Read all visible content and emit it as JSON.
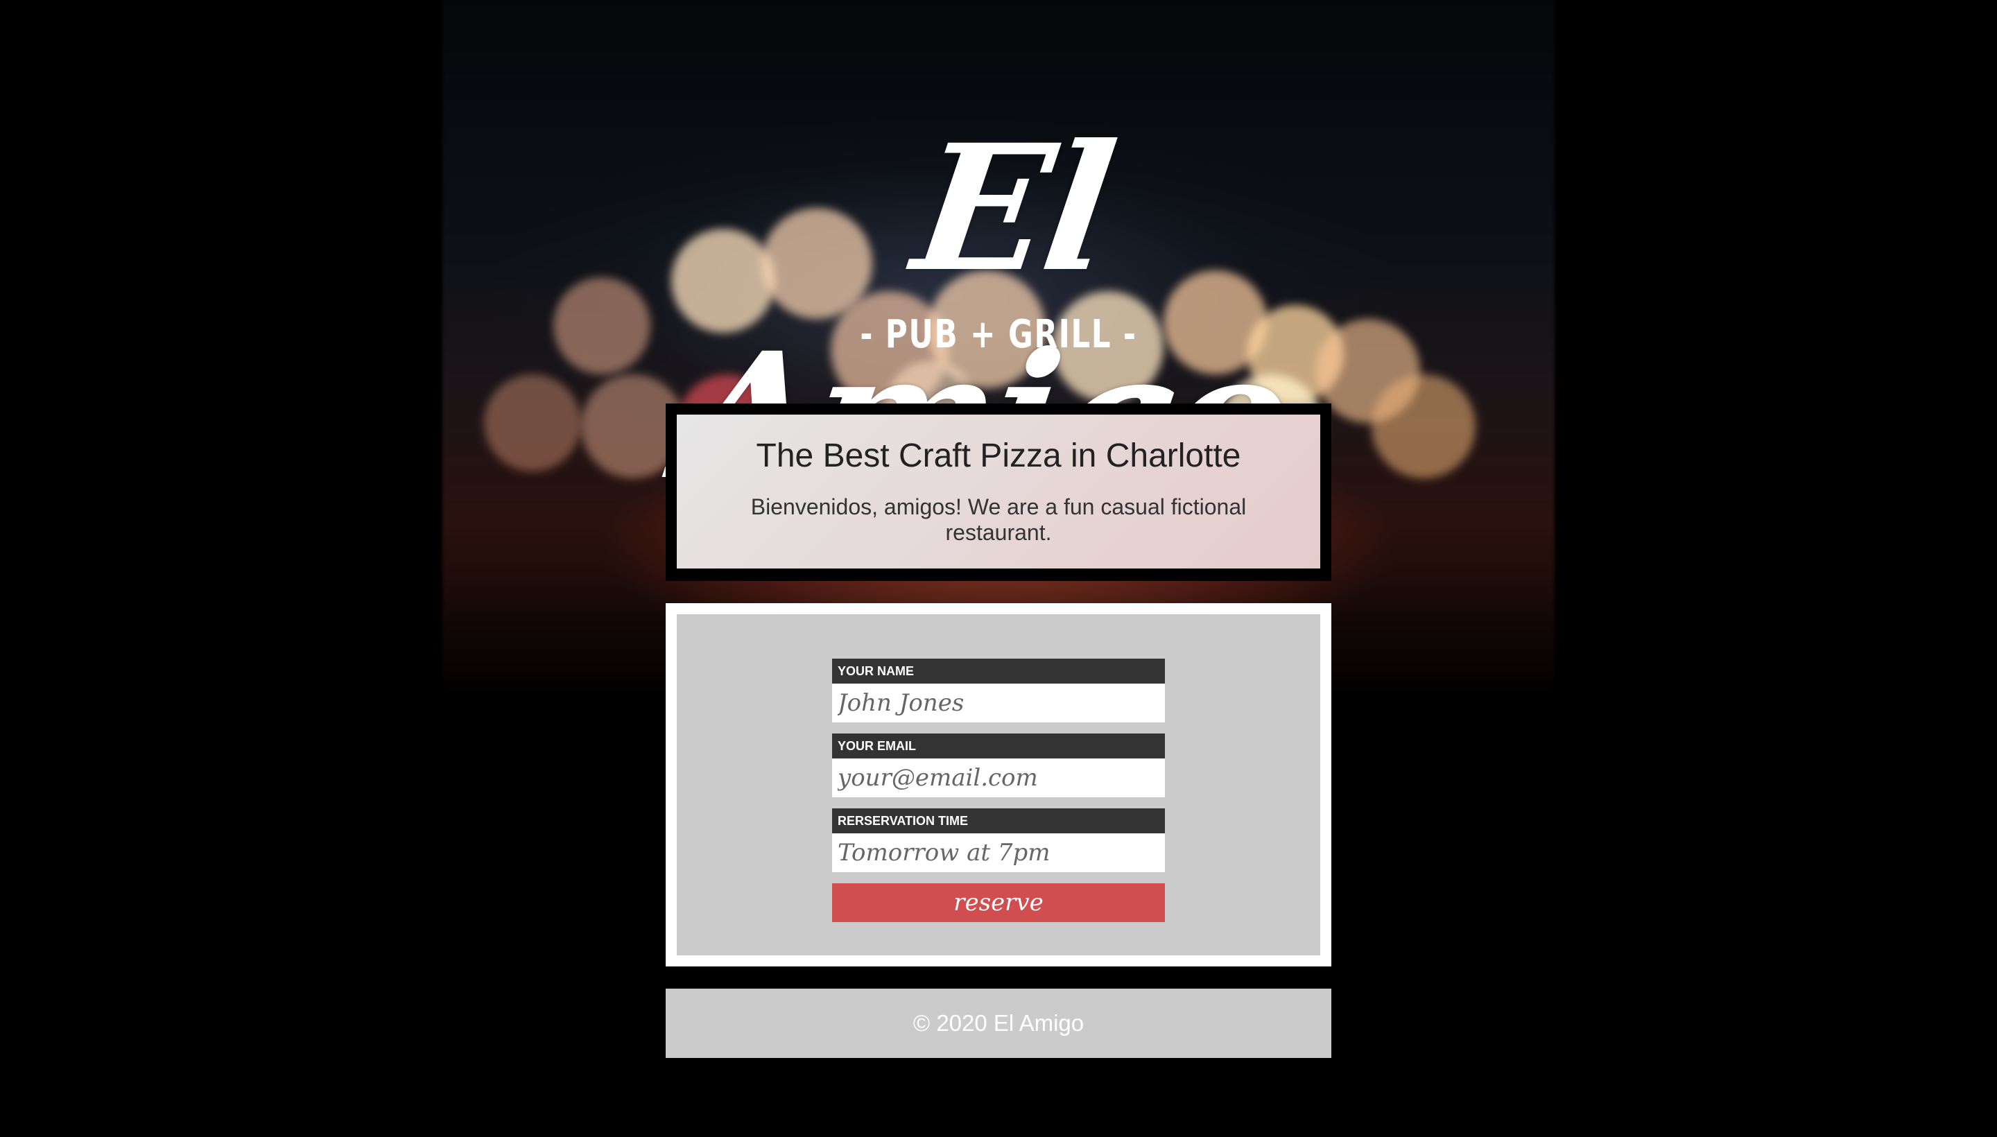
{
  "brand": {
    "logo_script": "El Amigo",
    "logo_sub": "- PUB + GRILL -"
  },
  "intro": {
    "title": "The Best Craft Pizza in Charlotte",
    "text": "Bienvenidos, amigos! We are a fun casual fictional restaurant."
  },
  "form": {
    "name_label": "YOUR NAME",
    "name_placeholder": "John Jones",
    "email_label": "YOUR EMAIL",
    "email_placeholder": "your@email.com",
    "time_label": "RERSERVATION TIME",
    "time_placeholder": "Tomorrow at 7pm",
    "submit_label": "reserve"
  },
  "footer": {
    "copyright": "© 2020 El Amigo"
  },
  "colors": {
    "background": "#000000",
    "form_panel": "#cbcbcb",
    "label_bar": "#333333",
    "button_accent": "#d14e50",
    "footer_bg": "#cbcbcb"
  }
}
